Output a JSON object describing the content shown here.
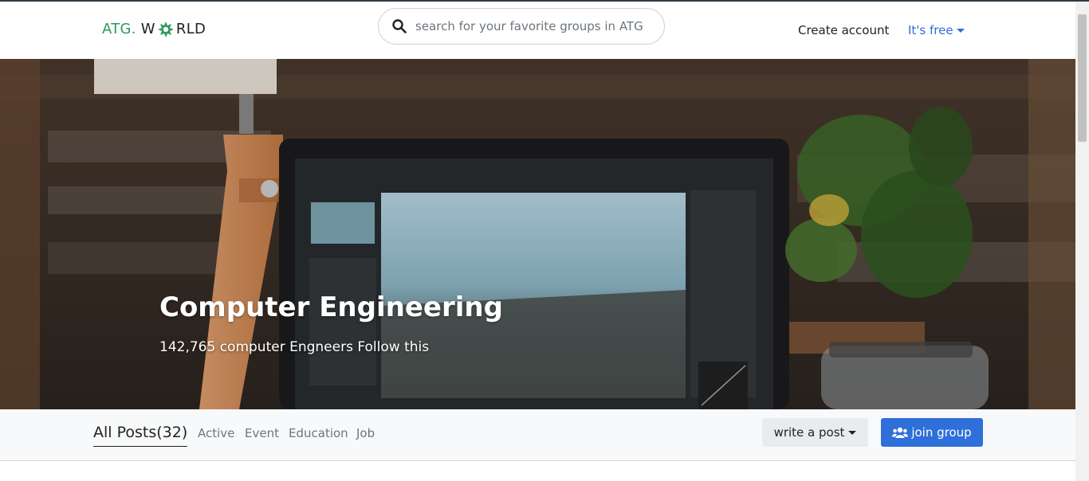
{
  "brand": {
    "part1": "ATG.",
    "part2": "W",
    "part3": "RLD",
    "accent_color": "#2e9a5a"
  },
  "search": {
    "placeholder": "search for your favorite groups in ATG",
    "icon": "search-icon"
  },
  "nav": {
    "create_account": "Create account",
    "its_free": "It's free"
  },
  "hero": {
    "title": "Computer Engineering",
    "subtitle": "142,765 computer Engneers Follow this"
  },
  "tabs": {
    "all_posts": "All Posts(32)",
    "items": [
      "Active",
      "Event",
      "Education",
      "Job"
    ]
  },
  "actions": {
    "write_post": "write a post",
    "join_group": "join group",
    "join_icon": "users-icon"
  },
  "colors": {
    "primary": "#2f6fd9",
    "secondary_bg": "#e9ecef",
    "bar_bg": "#f8f9fa"
  }
}
